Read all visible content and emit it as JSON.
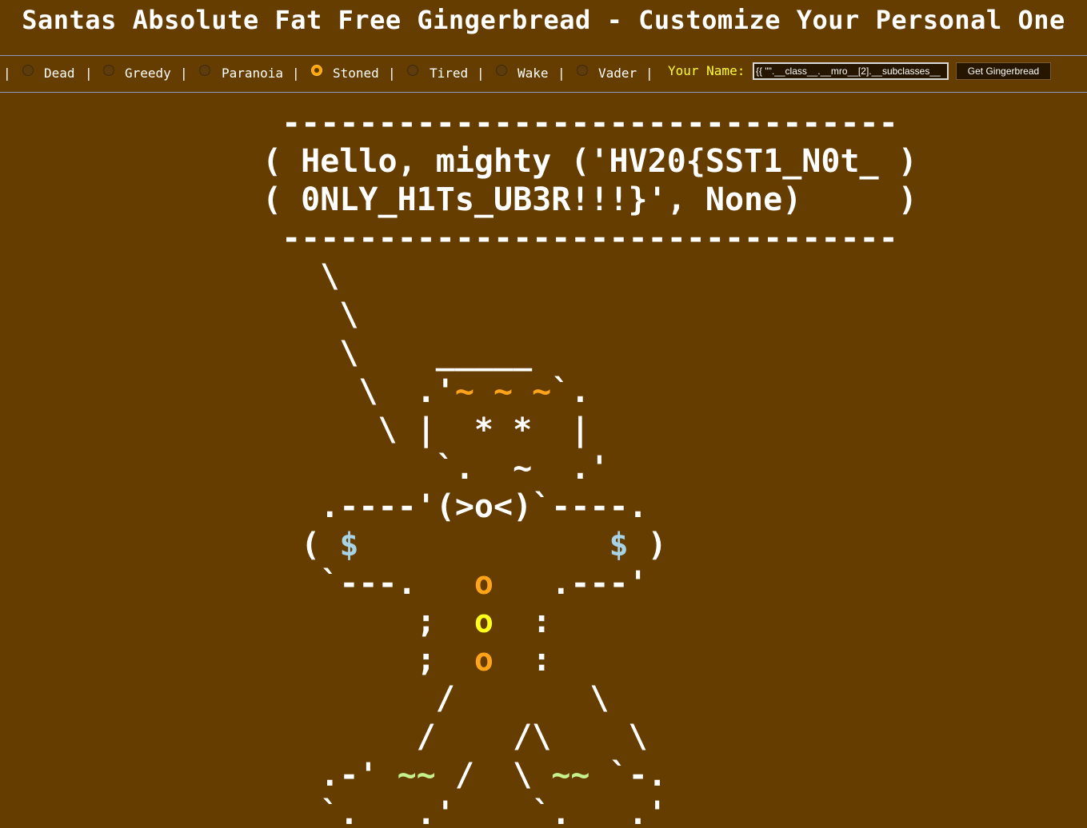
{
  "page": {
    "title": "Santas Absolute Fat Free Gingerbread - Customize Your Personal One"
  },
  "toolbar": {
    "separator": "|",
    "options": [
      {
        "label": "Dead",
        "checked": false
      },
      {
        "label": "Greedy",
        "checked": false
      },
      {
        "label": "Paranoia",
        "checked": false
      },
      {
        "label": "Stoned",
        "checked": true
      },
      {
        "label": "Tired",
        "checked": false
      },
      {
        "label": "Wake",
        "checked": false
      },
      {
        "label": "Vader",
        "checked": false
      }
    ],
    "name_label": "Your Name:",
    "name_value": "{{ \"\".__class__.__mro__[2].__subclasses__",
    "submit_label": "Get Gingerbread"
  },
  "gingerbread": {
    "bubble_top": " --------------------------------",
    "bubble_line1": "( Hello, mighty ('HV20{SST1_N0t_ )",
    "bubble_line2": "( 0NLY_H1Ts_UB3R!!!}', None)     )",
    "bubble_bottom": " --------------------------------",
    "tail1": "   \\",
    "tail2": "    \\",
    "head_top": "    \\    _____",
    "head_left": "     \\  .'",
    "eyebrows": "~ ~ ~",
    "head_right": "`.",
    "eyes_line": "      \\ |  * *  |",
    "nose_line": "         `.  ~  .'",
    "mouth_line": "   .----'(>o<)`----.",
    "arms_open": "  ( ",
    "hand_symbol": "$",
    "arms_gap": "             ",
    "arms_close": " )",
    "waist_left": "   `---.   ",
    "button_char": "o",
    "waist_right": "   .---'",
    "body_left": "        ;  ",
    "body_right": "  :",
    "legs1": "         /       \\",
    "legs2": "        /    /\\    \\",
    "feet_left": "   .-' ",
    "grass": "~~",
    "feet_mid": " /  \\ ",
    "feet_right": " `-.",
    "soles": "   `.___.'    `.___.'"
  },
  "colors": {
    "background": "#663d00",
    "accent_orange": "#ffa31a",
    "accent_yellow": "#ffff1a",
    "accent_blue": "#a8d3e6",
    "accent_green": "#c6f28c",
    "name_label": "#ffff33"
  }
}
